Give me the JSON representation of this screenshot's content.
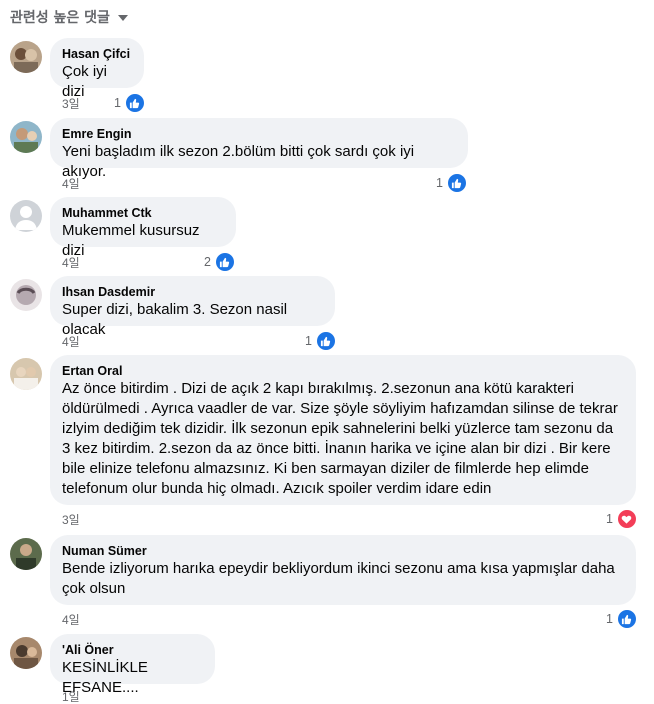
{
  "sort": {
    "label": "관련성 높은 댓글"
  },
  "comments": [
    {
      "author": "Hasan Çifci",
      "text": "Çok iyi dizi",
      "time": "3일",
      "reaction_count": "1",
      "reaction_type": "like-icon"
    },
    {
      "author": "Emre Engin",
      "text": "Yeni başladım ilk sezon 2.bölüm bitti çok sardı çok iyi akıyor.",
      "time": "4일",
      "reaction_count": "1",
      "reaction_type": "like-icon"
    },
    {
      "author": "Muhammet Ctk",
      "text": "Mukemmel kusursuz dizi",
      "time": "4일",
      "reaction_count": "2",
      "reaction_type": "like-icon"
    },
    {
      "author": "Ihsan Dasdemir",
      "text": "Super dizi, bakalim 3. Sezon nasil olacak",
      "time": "4일",
      "reaction_count": "1",
      "reaction_type": "like-icon"
    },
    {
      "author": "Ertan Oral",
      "text": "Az önce bitirdim . Dizi de açık 2 kapı bırakılmış. 2.sezonun ana kötü karakteri öldürülmedi . Ayrıca vaadler de var. Size şöyle söyliyim hafızamdan silinse de tekrar izlyim dediğim tek dizidir. İlk sezonun epik sahnelerini belki yüzlerce tam sezonu da 3 kez bitirdim. 2.sezon da az önce bitti. İnanın harika ve içine alan bir dizi . Bir kere bile elinize telefonu almazsınız. Ki ben sarmayan diziler de filmlerde hep elimde telefonum olur bunda hiç olmadı. Azıcık spoiler verdim idare edin",
      "time": "3일",
      "reaction_count": "1",
      "reaction_type": "love-icon"
    },
    {
      "author": "Numan Sümer",
      "text": "Bende izliyorum harıka epeydir bekliyordum ikinci sezonu ama kısa yapmışlar daha çok olsun",
      "time": "4일",
      "reaction_count": "1",
      "reaction_type": "like-icon"
    },
    {
      "author": "'Ali Öner",
      "text": "KESİNLİKLE EFSANE....",
      "time": "1일"
    }
  ],
  "colors": {
    "bubble": "#f0f2f5",
    "like": "#1b74e4",
    "love": "#f33e58",
    "meta": "#65676b"
  }
}
